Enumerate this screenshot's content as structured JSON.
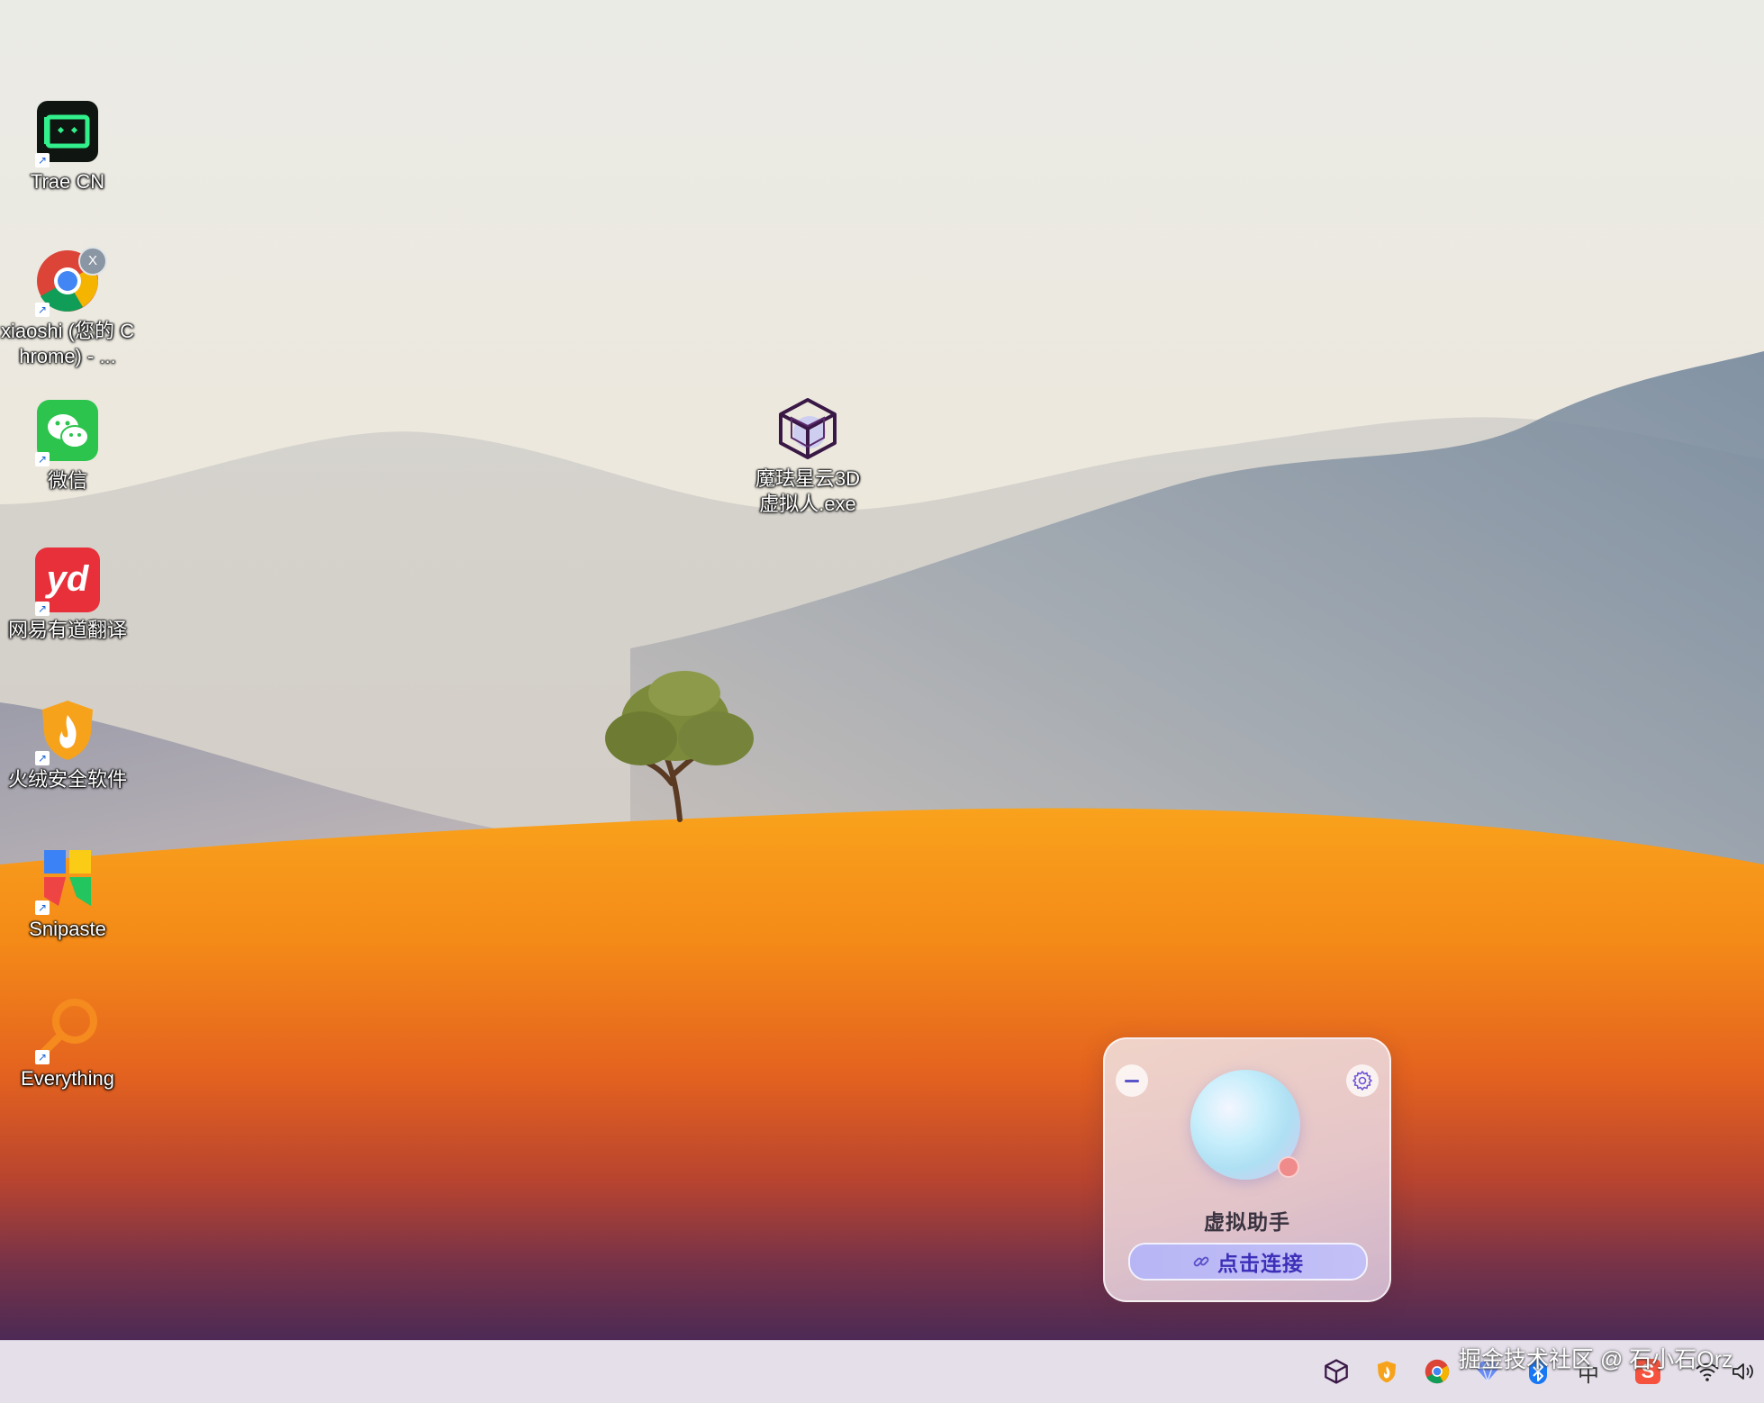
{
  "desktop": {
    "icons": [
      {
        "label": "Trae CN",
        "icon": "trae-cn-icon"
      },
      {
        "label": "xiaoshi (您的 Chrome) - ...",
        "icon": "chrome-profile-icon",
        "badge": "X"
      },
      {
        "label": "微信",
        "icon": "wechat-icon"
      },
      {
        "label": "网易有道翻译",
        "icon": "youdao-translate-icon",
        "glyph": "yd"
      },
      {
        "label": "火绒安全软件",
        "icon": "huorong-icon"
      },
      {
        "label": "Snipaste",
        "icon": "snipaste-icon"
      },
      {
        "label": "Everything",
        "icon": "everything-icon"
      }
    ],
    "center_icon": {
      "label": "魔珐星云3D虚拟人.exe",
      "icon": "cube-3d-icon"
    }
  },
  "assistant": {
    "title": "虚拟助手",
    "connect_label": "点击连接",
    "minimize_icon": "minus-icon",
    "settings_icon": "gear-icon",
    "status_color": "#f08b8b"
  },
  "taskbar": {
    "tray": [
      "cube-3d-icon",
      "huorong-icon",
      "chrome-icon",
      "diamond-vpn-icon",
      "bluetooth-icon",
      "ime-icon",
      "sogou-input-icon",
      "wifi-icon",
      "speaker-icon"
    ],
    "ime_label": "中",
    "sogou_label": "S"
  },
  "watermark": "掘金技术社区 @ 石小石Orz",
  "colors": {
    "desert": "#f28a1a",
    "accent": "#3d2fb8",
    "taskbar": "#e5dfea"
  }
}
